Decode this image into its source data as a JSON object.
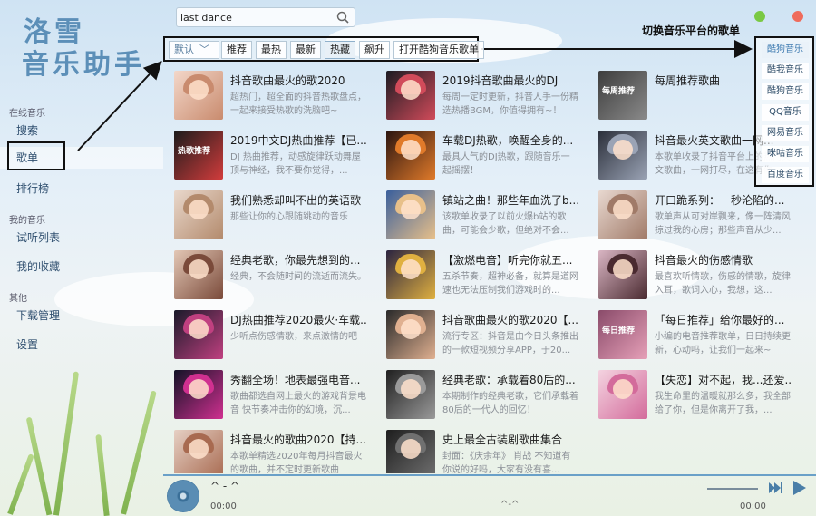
{
  "app": {
    "logo_line1": "洛雪",
    "logo_line2": "音乐助手"
  },
  "sidebar": {
    "section_online": "在线音乐",
    "search": "搜索",
    "playlist": "歌单",
    "charts": "排行榜",
    "section_mine": "我的音乐",
    "trial_list": "试听列表",
    "favorites": "我的收藏",
    "section_other": "其他",
    "downloads": "下载管理",
    "settings": "设置"
  },
  "search": {
    "value": "last dance",
    "icon": "search-icon"
  },
  "tabs": {
    "sort_select": "默认",
    "items": [
      "推荐",
      "最热",
      "最新",
      "热藏",
      "飙升",
      "打开酷狗音乐歌单"
    ],
    "active_index": 3
  },
  "annotation": {
    "switch_platform": "切换音乐平台的歌单"
  },
  "platforms": {
    "items": [
      "酷狗音乐",
      "酷我音乐",
      "酷狗音乐",
      "QQ音乐",
      "网易音乐",
      "咪咕音乐",
      "百度音乐"
    ],
    "active_index": 0
  },
  "playlists": [
    {
      "title": "抖音歌曲最火的歌2020",
      "desc": "超热门，超全面的抖音热歌盘点，一起来接受热歌的洗脑吧~",
      "cover_text": ""
    },
    {
      "title": "2019抖音歌曲最火的DJ",
      "desc": "每周一定时更新，抖音人手一份精选热播BGM，你值得拥有~！",
      "cover_text": ""
    },
    {
      "title": "每周推荐歌曲",
      "desc": "",
      "cover_text": "每周推荐"
    },
    {
      "title": "2019中文DJ热曲推荐【已...",
      "desc": "DJ 热曲推荐，动感旋律跃动舞屋顶与神经，我不要你觉得，...",
      "cover_text": "热歌推荐"
    },
    {
      "title": "车载DJ热歌，唤醒全身的...",
      "desc": "最具人气的DJ热歌，跟随音乐一起摇摆！",
      "cover_text": ""
    },
    {
      "title": "抖音最火英文歌曲一网...",
      "desc": "本歌单收录了抖音平台上的热门英文歌曲，一网打尽，在这有你...",
      "cover_text": ""
    },
    {
      "title": "我们熟悉却叫不出的英语歌",
      "desc": "那些让你的心跟随跳动的音乐",
      "cover_text": ""
    },
    {
      "title": "镇站之曲！那些年血洗了b...",
      "desc": "该歌单收录了以前火爆b站的歌曲，可能会少歌，但绝对不会...",
      "cover_text": ""
    },
    {
      "title": "开口跪系列：一秒沦陷的...",
      "desc": "歌单声从可对岸飘来，像一阵清风掠过我的心房；那些声音从少...",
      "cover_text": ""
    },
    {
      "title": "经典老歌，你最先想到的...",
      "desc": "经典，不会随时间的流逝而流失。",
      "cover_text": ""
    },
    {
      "title": "【激燃电音】听完你就五...",
      "desc": "五杀节奏，超神必备，就算是道网速也无法压制我们游戏时的...",
      "cover_text": ""
    },
    {
      "title": "抖音最火的伤感情歌",
      "desc": "最喜欢听情歌，伤感的情歌，旋律入耳，歌词入心，我想，这...",
      "cover_text": ""
    },
    {
      "title": "DJ热曲推荐2020最火·车载...",
      "desc": "少听点伤感情歌，来点激情的吧",
      "cover_text": ""
    },
    {
      "title": "抖音歌曲最火的歌2020【...",
      "desc": "流行专区：抖音是由今日头条推出的一款短视频分享APP，于20...",
      "cover_text": ""
    },
    {
      "title": "「每日推荐」给你最好的...",
      "desc": "小编的电音推荐歌单，日日持续更新，心动吗，让我们一起来~",
      "cover_text": "每日推荐"
    },
    {
      "title": "秀翻全场！地表最强电音...",
      "desc": "歌曲都选自网上最火的游戏背景电音 快节奏冲击你的幻境，沉...",
      "cover_text": ""
    },
    {
      "title": "经典老歌：承载着80后的...",
      "desc": "本期制作的经典老歌，它们承载着80后的一代人的回忆！",
      "cover_text": ""
    },
    {
      "title": "【失恋】对不起，我...还爱...",
      "desc": "我生命里的温暖就那么多，我全部给了你，但是你离开了我，...",
      "cover_text": ""
    },
    {
      "title": "抖音最火的歌曲2020【持...",
      "desc": "本歌单精选2020年每月抖音最火的歌曲，并不定时更新歌曲",
      "cover_text": ""
    },
    {
      "title": "史上最全古装剧歌曲集合",
      "desc": "封面：《庆余年》 肖战 不知道有你说的好吗，大家有没有喜...",
      "cover_text": ""
    }
  ],
  "player": {
    "song": "^ - ^",
    "song_mid": "^-^",
    "time_current": "00:00",
    "time_total": "00:00",
    "volume": 0.7
  },
  "colors": {
    "accent": "#5c8fb8",
    "win_green": "#7ac943",
    "win_red": "#ef6b5b"
  }
}
